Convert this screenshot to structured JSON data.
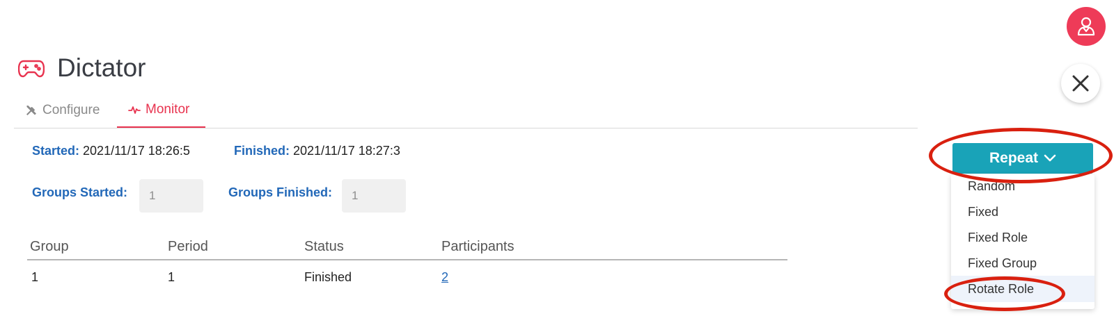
{
  "header": {
    "title": "Dictator",
    "title_icon": "gamepad-icon",
    "avatar_icon": "user-icon",
    "close_icon": "close-icon"
  },
  "tabs": [
    {
      "label": "Configure",
      "icon": "tools-icon",
      "active": false
    },
    {
      "label": "Monitor",
      "icon": "activity-icon",
      "active": true
    }
  ],
  "info": {
    "started_label": "Started:",
    "started_value": "2021/11/17 18:26:5",
    "finished_label": "Finished:",
    "finished_value": "2021/11/17 18:27:3",
    "groups_started_label": "Groups Started:",
    "groups_started_value": "1",
    "groups_finished_label": "Groups Finished:",
    "groups_finished_value": "1"
  },
  "table": {
    "columns": [
      "Group",
      "Period",
      "Status",
      "Participants"
    ],
    "rows": [
      {
        "group": "1",
        "period": "1",
        "status": "Finished",
        "participants": "2"
      }
    ]
  },
  "repeat": {
    "label": "Repeat",
    "items": [
      "Random",
      "Fixed",
      "Fixed Role",
      "Fixed Group",
      "Rotate Role"
    ],
    "highlighted": "Rotate Role"
  },
  "colors": {
    "accent": "#e8334f",
    "avatar": "#ee3b58",
    "link": "#2268b8",
    "button": "#19a3b8",
    "annotation": "#d9200f"
  }
}
